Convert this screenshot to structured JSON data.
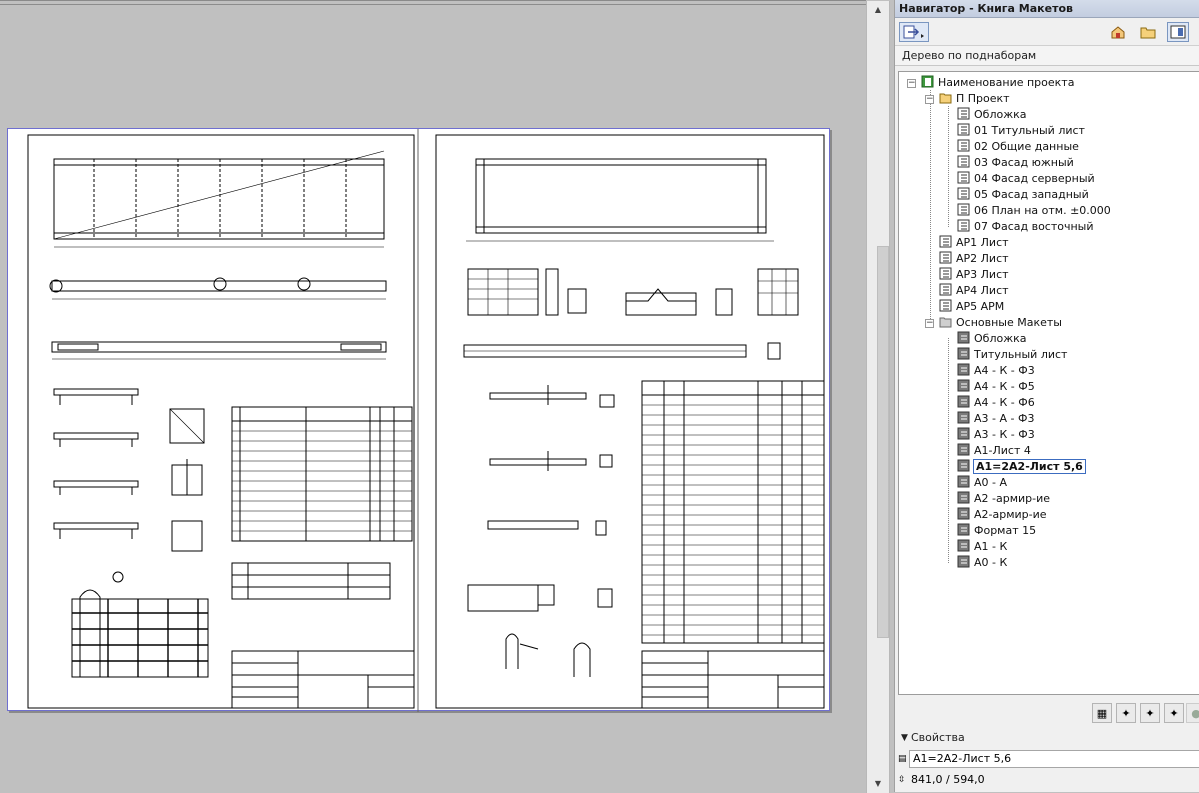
{
  "navigator": {
    "title": "Навигатор - Книга Макетов",
    "mode": "Дерево по поднаборам",
    "tree": {
      "root": "Наименование проекта",
      "groups": [
        {
          "label": "П Проект",
          "items": [
            "Обложка",
            "01 Титульный лист",
            "02 Общие данные",
            "03 Фасад южный",
            "04 Фасад серверный",
            "05 Фасад западный",
            "06 План на отм. ±0.000",
            "07 Фасад восточный"
          ]
        }
      ],
      "loose_items": [
        "АР1 Лист",
        "АР2 Лист",
        "АР3 Лист",
        "АР4 Лист",
        "АР5 АРМ"
      ],
      "masters": {
        "label": "Основные Макеты",
        "items": [
          "Обложка",
          "Титульный лист",
          "А4 - К - Ф3",
          "А4 - К - Ф5",
          "А4 - К - Ф6",
          "А3 - А - Ф3",
          "А3 - К - Ф3",
          "А1-Лист 4",
          "А1=2А2-Лист 5,6",
          "А0 - А",
          "А2 -армир-ие",
          "А2-армир-ие",
          "Формат 15",
          "А1 - К",
          "А0 - К"
        ],
        "selected_index": 8
      }
    },
    "properties": {
      "label": "Свойства",
      "name_value": "А1=2А2-Лист 5,6",
      "size_value": "841,0 / 594,0"
    }
  },
  "colors": {
    "canvas": "#c0c0c0",
    "sheet_border": "#6f6fd0",
    "selection": "#3c6cc0"
  }
}
